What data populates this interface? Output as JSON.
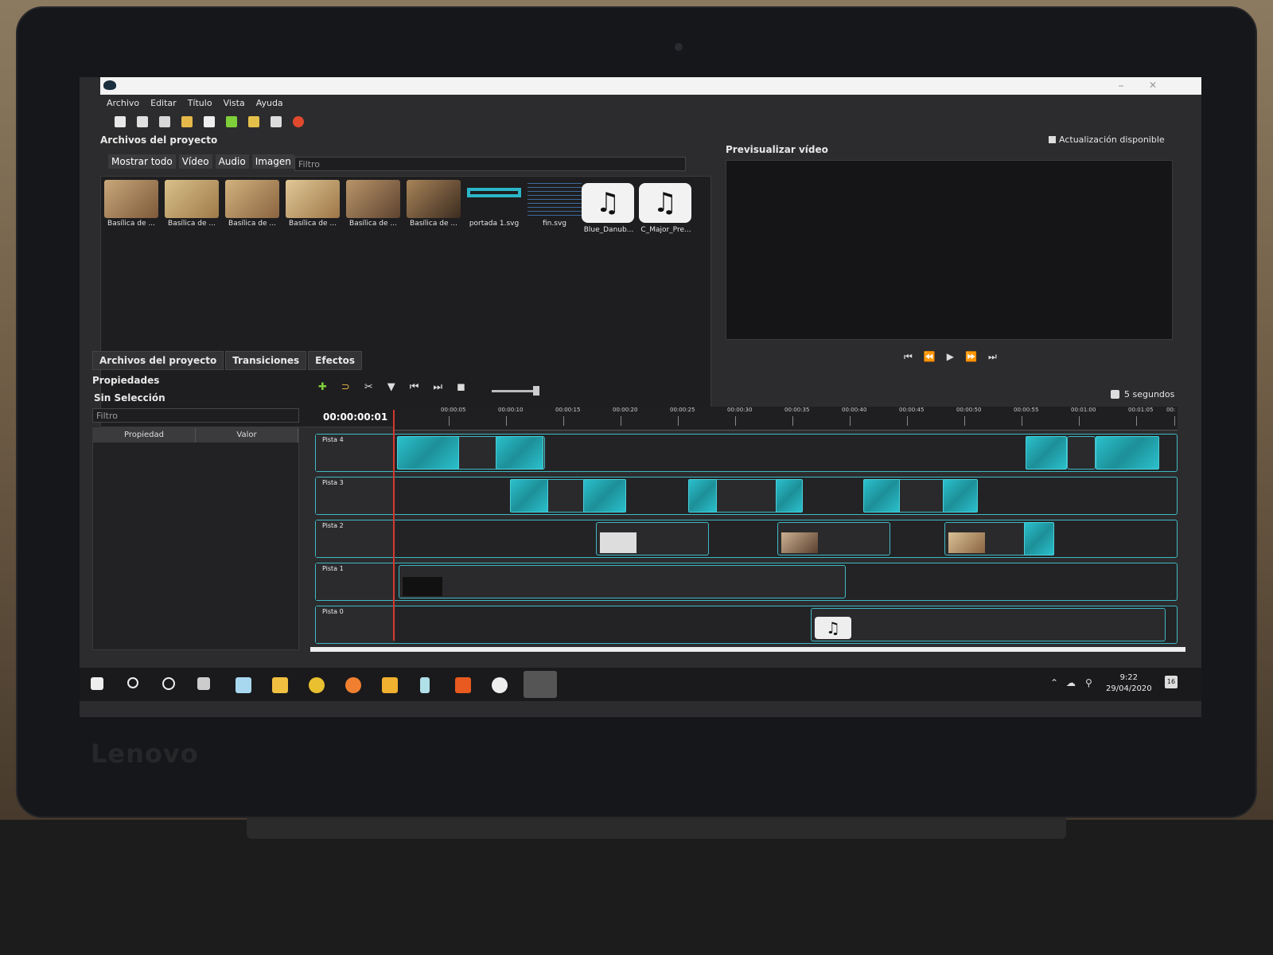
{
  "menu": {
    "items": [
      "Archivo",
      "Editar",
      "Título",
      "Vista",
      "Ayuda"
    ]
  },
  "files_panel": {
    "title": "Archivos del proyecto",
    "tabs": [
      "Mostrar todo",
      "Vídeo",
      "Audio",
      "Imagen"
    ],
    "filter_placeholder": "Filtro",
    "items": [
      "Basílica de ...",
      "Basílica de ...",
      "Basílica de ...",
      "Basílica de ...",
      "Basílica de ...",
      "Basílica de ...",
      "portada 1.svg",
      "fin.svg",
      "Blue_Danub...",
      "C_Major_Pre..."
    ]
  },
  "preview": {
    "title": "Previsualizar vídeo",
    "update_label": "Actualización disponible"
  },
  "lower_tabs": [
    "Archivos del proyecto",
    "Transiciones",
    "Efectos"
  ],
  "properties": {
    "title": "Propiedades",
    "selection": "Sin Selección",
    "filter_placeholder": "Filtro",
    "col_property": "Propiedad",
    "col_value": "Valor"
  },
  "timeline": {
    "timecode": "00:00:00:01",
    "seconds_label": "5 segundos",
    "ruler_ticks": [
      "00:00:05",
      "00:00:10",
      "00:00:15",
      "00:00:20",
      "00:00:25",
      "00:00:30",
      "00:00:35",
      "00:00:40",
      "00:00:45",
      "00:00:50",
      "00:00:55",
      "00:01:00",
      "00:01:05",
      "00:"
    ],
    "tracks": [
      "Pista 4",
      "Pista 3",
      "Pista 2",
      "Pista 1",
      "Pista 0"
    ]
  },
  "taskbar": {
    "time": "9:22",
    "date": "29/04/2020",
    "notifications": "16"
  },
  "device_brand": "Lenovo",
  "colors": {
    "accent": "#3fb9c4",
    "playhead": "#d23a2c",
    "background": "#2c2c2e"
  }
}
